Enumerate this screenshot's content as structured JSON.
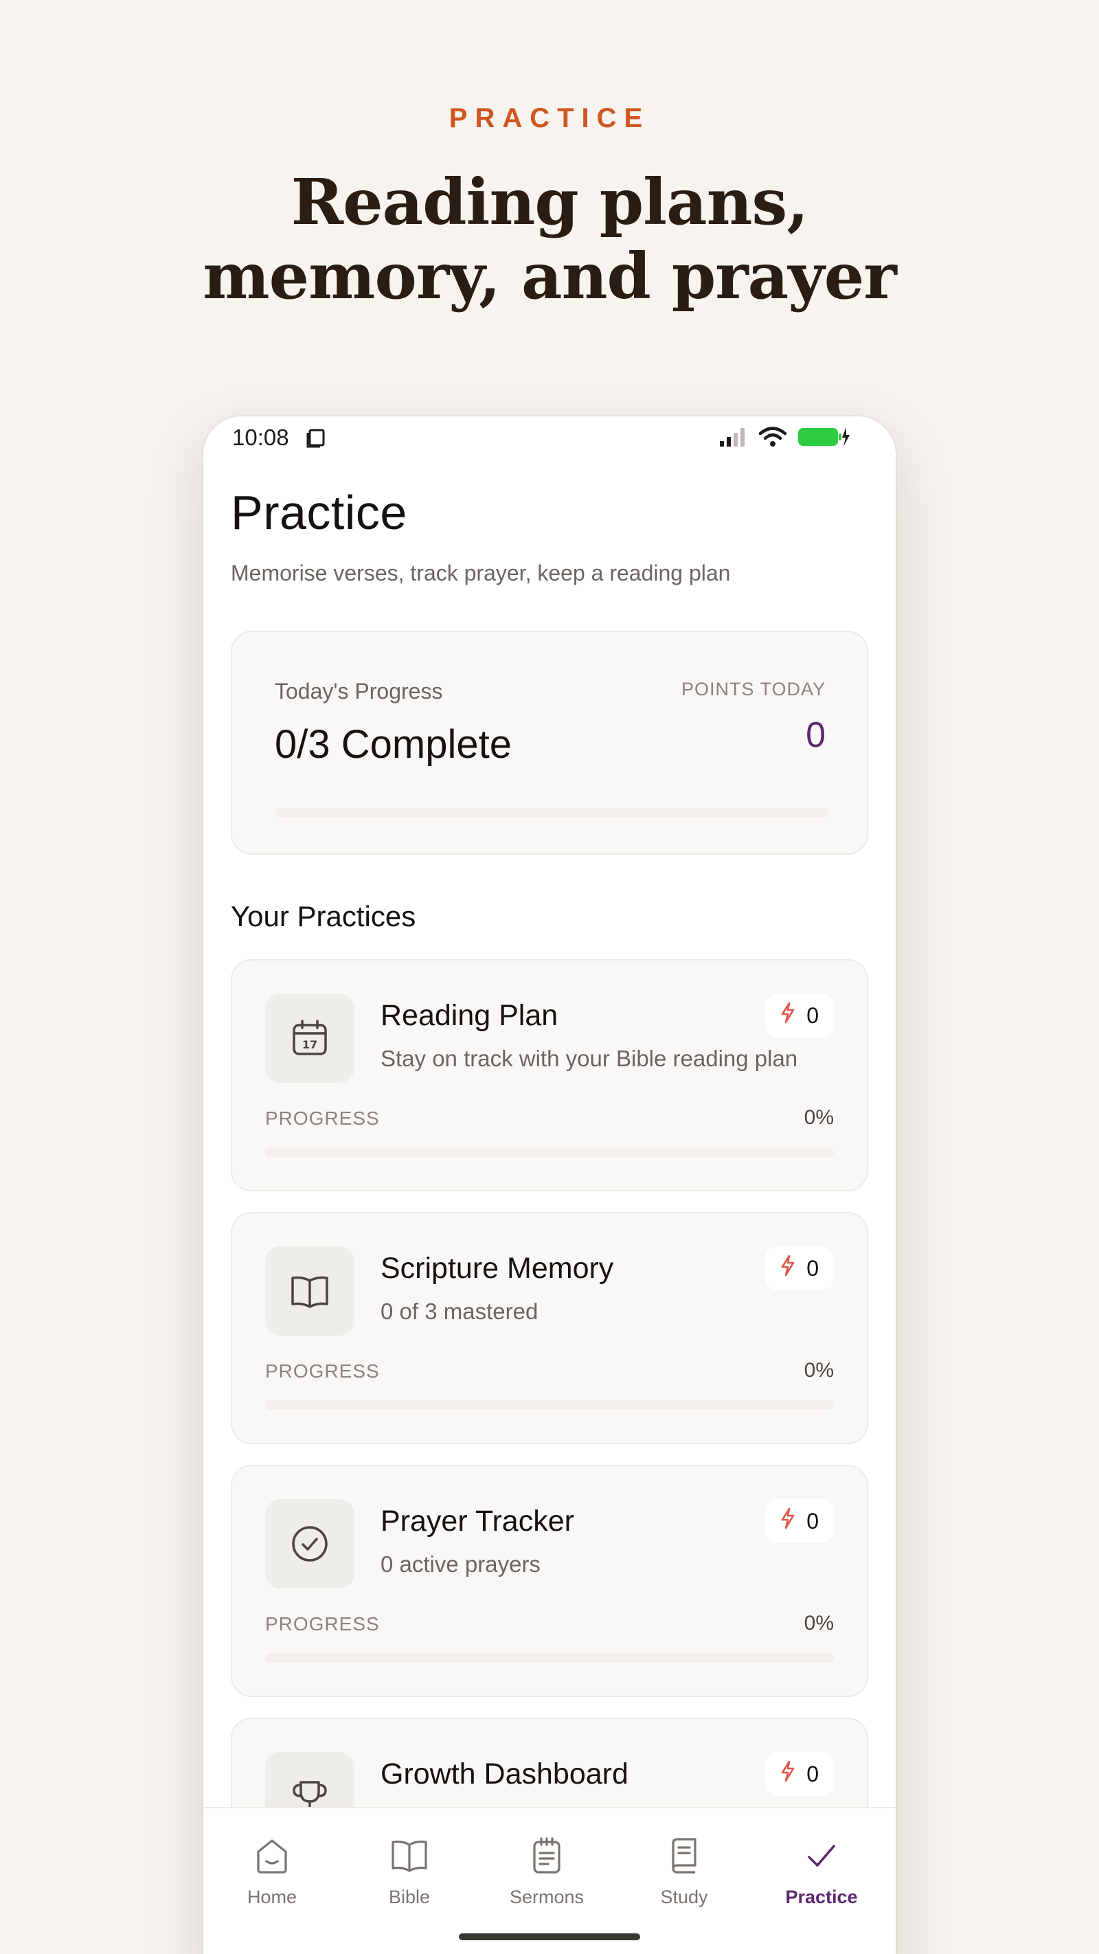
{
  "hero": {
    "eyebrow": "PRACTICE",
    "headline_line1": "Reading plans,",
    "headline_line2": "memory, and prayer"
  },
  "status_bar": {
    "time": "10:08",
    "battery_color": "#2ecc40"
  },
  "page": {
    "title": "Practice",
    "subtitle": "Memorise verses, track prayer, keep a reading plan"
  },
  "progress_card": {
    "label": "Today's Progress",
    "value": "0/3 Complete",
    "points_label": "POINTS TODAY",
    "points_value": "0",
    "progress_fraction": 0
  },
  "section": {
    "title": "Your Practices"
  },
  "practices": [
    {
      "title": "Reading Plan",
      "description": "Stay on track with your Bible reading plan",
      "icon": "calendar-icon",
      "points": "0",
      "progress_label": "PROGRESS",
      "progress_value": "0%",
      "progress_fraction": 0
    },
    {
      "title": "Scripture Memory",
      "description": "0 of 3 mastered",
      "icon": "book-open-icon",
      "points": "0",
      "progress_label": "PROGRESS",
      "progress_value": "0%",
      "progress_fraction": 0
    },
    {
      "title": "Prayer Tracker",
      "description": "0 active prayers",
      "icon": "check-circle-icon",
      "points": "0",
      "progress_label": "PROGRESS",
      "progress_value": "0%",
      "progress_fraction": 0
    },
    {
      "title": "Growth Dashboard",
      "description": "",
      "icon": "trophy-icon",
      "points": "0",
      "progress_label": "",
      "progress_value": "",
      "progress_fraction": 0
    }
  ],
  "tabs": [
    {
      "label": "Home",
      "icon": "home-icon",
      "active": false
    },
    {
      "label": "Bible",
      "icon": "book-icon",
      "active": false
    },
    {
      "label": "Sermons",
      "icon": "notepad-icon",
      "active": false
    },
    {
      "label": "Study",
      "icon": "study-book-icon",
      "active": false
    },
    {
      "label": "Practice",
      "icon": "check-icon",
      "active": true
    }
  ],
  "colors": {
    "accent": "#5b2a6e",
    "eyebrow": "#d0561f",
    "bolt": "#e0574a",
    "background": "#f7f3ef"
  }
}
